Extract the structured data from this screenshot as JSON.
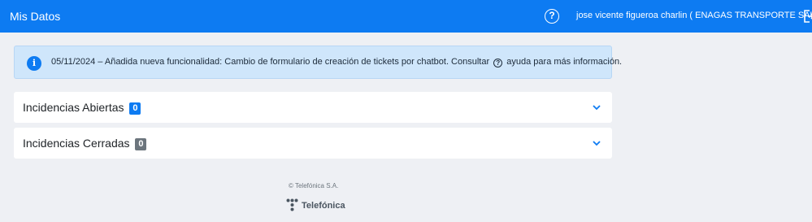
{
  "header": {
    "title": "Mis Datos",
    "help_glyph": "?",
    "user": "jose vicente figueroa charlin ( ENAGAS TRANSPORTE SAU )",
    "icons": {
      "help": "help-circle-icon",
      "logout": "logout-icon"
    },
    "background_color": "#0d7bf2"
  },
  "alert": {
    "icon": "info-icon",
    "info_glyph": "i",
    "text_before": "05/11/2024 – Añadida nueva funcionalidad: Cambio de formulario de creación de tickets por chatbot. Consultar",
    "help_glyph": "?",
    "text_after": "ayuda para más información.",
    "background_color": "#cfe6fb"
  },
  "panels": [
    {
      "label": "Incidencias Abiertas",
      "count": "0",
      "badge_color": "#0d7bf2",
      "icon": "chevron-down-icon"
    },
    {
      "label": "Incidencias Cerradas",
      "count": "0",
      "badge_color": "#6c757d",
      "icon": "chevron-down-icon"
    }
  ],
  "footer": {
    "copyright": "© Telefónica S.A.",
    "logo_text": "Telefónica",
    "logo_icon": "telefonica-logo-icon"
  }
}
